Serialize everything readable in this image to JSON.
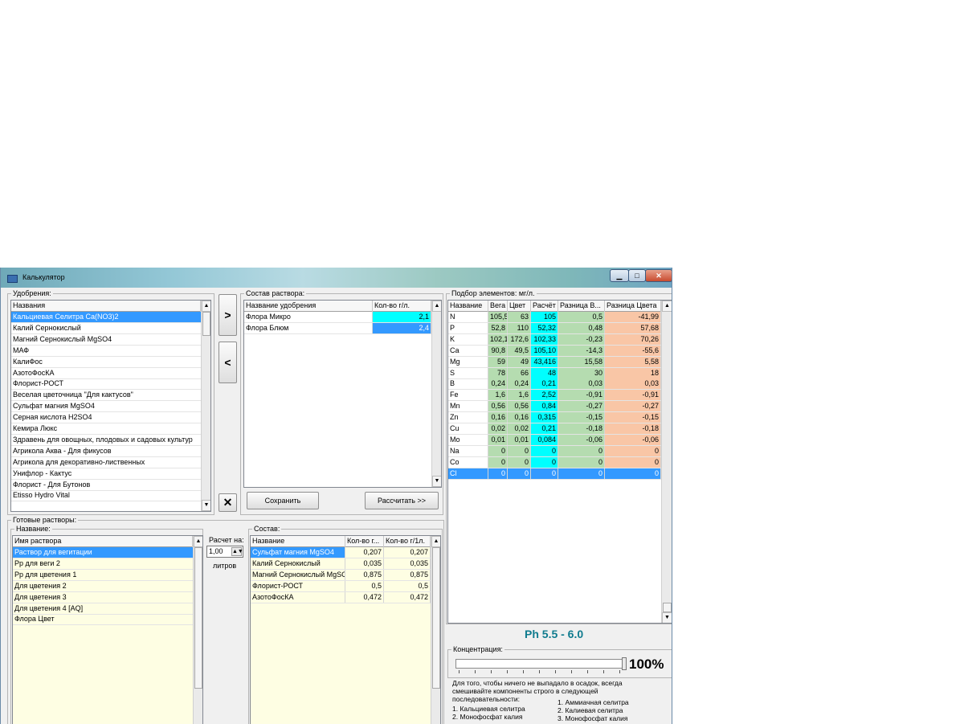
{
  "window": {
    "title": "Калькулятор"
  },
  "fertilizers": {
    "group_label": "Удобрения:",
    "column_header": "Названия",
    "items": [
      "Кальциевая Селитра Ca(NO3)2",
      "Калий Сернокислый",
      "Магний Сернокислый MgSO4",
      "МАФ",
      "КалиФос",
      "АзотоФосКА",
      "Флорист-РОСТ",
      "Веселая цветочница \"Для кактусов\"",
      "Сульфат магния MgSO4",
      "Серная кислота H2SO4",
      "Кемира Люкс",
      "Здравень для овощных, плодовых и садовых культур",
      "Агрикола Аква - Для фикусов",
      "Агрикола для декоративно-лиственных",
      "Унифлор - Кактус",
      "Флорист - Для Бутонов",
      "Etisso Hydro Vital"
    ],
    "selected_index": 0
  },
  "buttons": {
    "add": ">",
    "remove": "<",
    "clear": "✕",
    "save": "Сохранить",
    "calculate": "Рассчитать >>"
  },
  "solution": {
    "group_label": "Состав раствора:",
    "col_name": "Название удобрения",
    "col_amount": "Кол-во г/л.",
    "rows": [
      {
        "name": "Флора Микро",
        "amount": "2,1"
      },
      {
        "name": "Флора Блюм",
        "amount": "2,4"
      }
    ]
  },
  "elements": {
    "group_label": "Подбор элементов: мг/л.",
    "headers": [
      "Название",
      "Вега",
      "Цвет",
      "Расчёт",
      "Разница В...",
      "Разница Цвета"
    ],
    "rows": [
      [
        "N",
        "105,5",
        "63",
        "105",
        "0,5",
        "-41,99"
      ],
      [
        "P",
        "52,8",
        "110",
        "52,32",
        "0,48",
        "57,68"
      ],
      [
        "K",
        "102,1",
        "172,6",
        "102,33",
        "-0,23",
        "70,26"
      ],
      [
        "Ca",
        "90,8",
        "49,5",
        "105,10",
        "-14,3",
        "-55,6"
      ],
      [
        "Mg",
        "59",
        "49",
        "43,416",
        "15,58",
        "5,58"
      ],
      [
        "S",
        "78",
        "66",
        "48",
        "30",
        "18"
      ],
      [
        "B",
        "0,24",
        "0,24",
        "0,21",
        "0,03",
        "0,03"
      ],
      [
        "Fe",
        "1,6",
        "1,6",
        "2,52",
        "-0,91",
        "-0,91"
      ],
      [
        "Mn",
        "0,56",
        "0,56",
        "0,84",
        "-0,27",
        "-0,27"
      ],
      [
        "Zn",
        "0,16",
        "0,16",
        "0,315",
        "-0,15",
        "-0,15"
      ],
      [
        "Cu",
        "0,02",
        "0,02",
        "0,21",
        "-0,18",
        "-0,18"
      ],
      [
        "Mo",
        "0,01",
        "0,01",
        "0,084",
        "-0,06",
        "-0,06"
      ],
      [
        "Na",
        "0",
        "0",
        "0",
        "0",
        "0"
      ],
      [
        "Co",
        "0",
        "0",
        "0",
        "0",
        "0"
      ],
      [
        "Cl",
        "0",
        "0",
        "0",
        "0",
        "0"
      ]
    ],
    "selected_index": 14
  },
  "ph": "Ph 5.5 - 6.0",
  "concentration": {
    "group_label": "Концентрация:",
    "value_text": "100%",
    "level": 1.0
  },
  "note": {
    "intro": [
      "Для того, чтобы ничего не выпадало в осадок, всегда",
      "смешивайте компоненты строго в следующей",
      "последовательности:"
    ],
    "left": [
      "1. Кальциевая селитра",
      "2. Монофосфат калия"
    ],
    "right": [
      "1. Аммиачная селитра",
      "2. Калиевая селитра",
      "3. Монофосфат калия"
    ]
  },
  "ready": {
    "group_label": "Готовые растворы:",
    "name_label": "Название:",
    "column_header": "Имя раствора",
    "items": [
      "Раствор для вегитации",
      "Рр для веги 2",
      "Рр для цветения 1",
      "Для цветения 2",
      "Для цветения 3",
      "Для цветения 4 [AQ]",
      "Флора Цвет"
    ],
    "selected_index": 0
  },
  "calc": {
    "label": "Расчет на:",
    "value": "1,00",
    "unit": "литров"
  },
  "composition": {
    "group_label": "Состав:",
    "headers": [
      "Название",
      "Кол-во г...",
      "Кол-во г/1л."
    ],
    "rows": [
      [
        "Сульфат магния MgSO4",
        "0,207",
        "0,207"
      ],
      [
        "Калий Сернокислый",
        "0,035",
        "0,035"
      ],
      [
        "Магний Сернокислый MgSO4",
        "0,875",
        "0,875"
      ],
      [
        "Флорист-РОСТ",
        "0,5",
        "0,5"
      ],
      [
        "АзотоФосКА",
        "0,472",
        "0,472"
      ]
    ],
    "selected_index": 0
  }
}
